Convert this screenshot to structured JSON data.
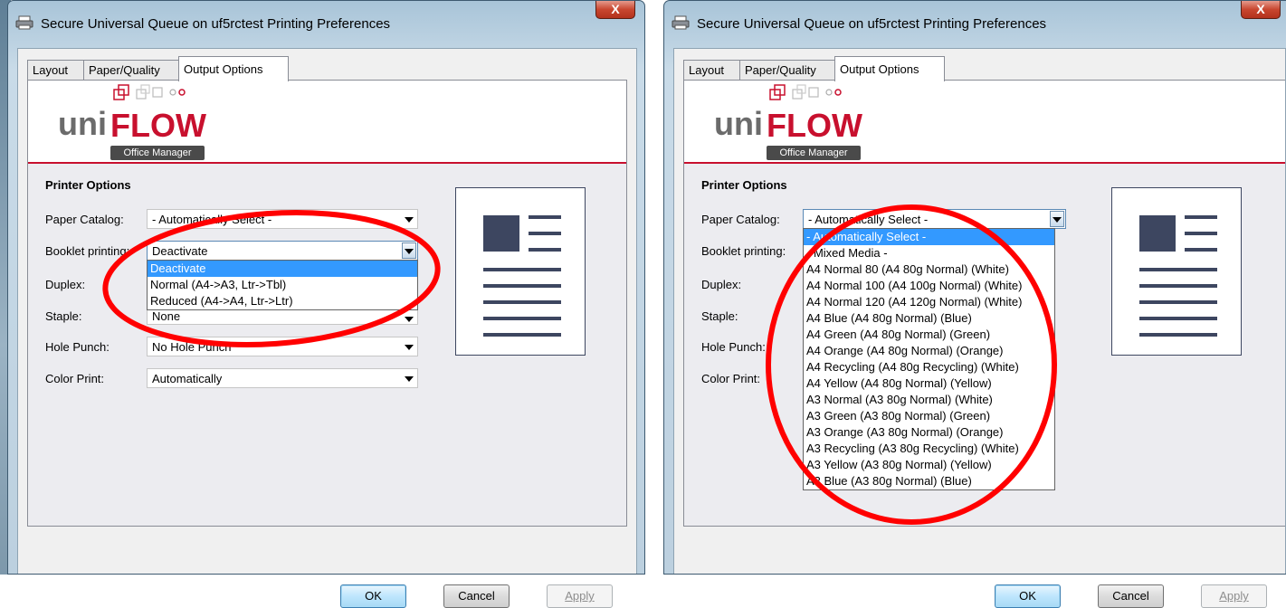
{
  "left": {
    "title": "Secure Universal Queue on uf5rctest Printing Preferences",
    "close": "X",
    "tabs": [
      "Layout",
      "Paper/Quality",
      "Output Options"
    ],
    "logo": {
      "brand_part1": "uni",
      "brand_part2": "FLOW",
      "badge": "Office Manager"
    },
    "section_title": "Printer Options",
    "labels": {
      "paper_catalog": "Paper Catalog:",
      "booklet": "Booklet printing:",
      "duplex": "Duplex:",
      "staple": "Staple:",
      "hole_punch": "Hole Punch:",
      "color_print": "Color Print:"
    },
    "values": {
      "paper_catalog": "- Automatically Select -",
      "booklet": "Deactivate",
      "staple": "None",
      "hole_punch": "No Hole Punch",
      "color_print": "Automatically"
    },
    "booklet_options": [
      "Deactivate",
      "Normal (A4->A3, Ltr->Tbl)",
      "Reduced (A4->A4, Ltr->Ltr)"
    ],
    "buttons": {
      "ok": "OK",
      "cancel": "Cancel",
      "apply": "Apply"
    }
  },
  "right": {
    "title": "Secure Universal Queue on uf5rctest Printing Preferences",
    "close": "X",
    "tabs": [
      "Layout",
      "Paper/Quality",
      "Output Options"
    ],
    "logo": {
      "brand_part1": "uni",
      "brand_part2": "FLOW",
      "badge": "Office Manager"
    },
    "section_title": "Printer Options",
    "labels": {
      "paper_catalog": "Paper Catalog:",
      "booklet": "Booklet printing:",
      "duplex": "Duplex:",
      "staple": "Staple:",
      "hole_punch": "Hole Punch:",
      "color_print": "Color Print:"
    },
    "values": {
      "paper_catalog": "- Automatically Select -"
    },
    "paper_options": [
      "- Automatically Select -",
      "- Mixed Media -",
      "A4 Normal 80 (A4 80g Normal) (White)",
      "A4 Normal 100 (A4 100g Normal) (White)",
      "A4 Normal 120 (A4 120g Normal) (White)",
      "A4 Blue (A4 80g Normal) (Blue)",
      "A4 Green (A4 80g Normal) (Green)",
      "A4 Orange (A4 80g Normal) (Orange)",
      "A4 Recycling (A4 80g Recycling) (White)",
      "A4 Yellow (A4 80g Normal) (Yellow)",
      "A3 Normal (A3 80g Normal) (White)",
      "A3 Green (A3 80g Normal) (Green)",
      "A3 Orange (A3 80g Normal) (Orange)",
      "A3 Recycling (A3 80g Recycling) (White)",
      "A3 Yellow (A3 80g Normal) (Yellow)",
      "A3 Blue (A3 80g Normal) (Blue)"
    ],
    "buttons": {
      "ok": "OK",
      "cancel": "Cancel",
      "apply": "Apply"
    }
  },
  "colors": {
    "brand_red": "#c8102e",
    "selection_blue": "#3399ff",
    "annotation_red": "#ff0000"
  }
}
